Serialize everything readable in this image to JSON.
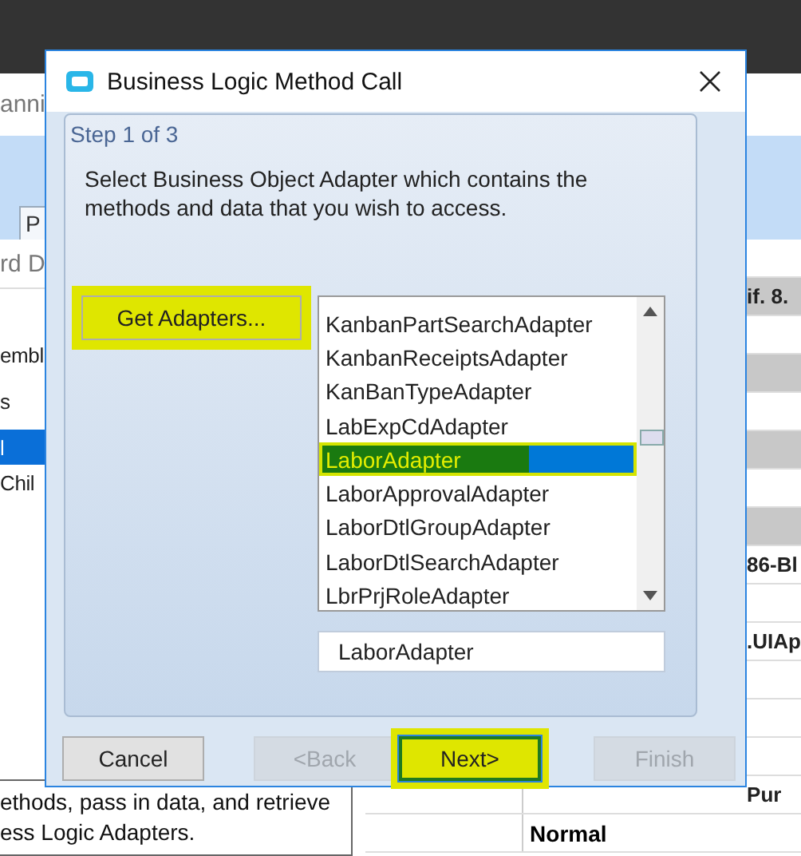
{
  "background_app": {
    "header_text": "anni",
    "tab_label": "P",
    "field_text": "rd D",
    "tree_items": [
      {
        "label": "embl",
        "selected": false
      },
      {
        "label": "s",
        "selected": false
      },
      {
        "label": "l",
        "selected": true
      },
      {
        "label": "Chil",
        "selected": false
      }
    ],
    "grid_rows": [
      {
        "shaded": false
      },
      {
        "shaded": true,
        "column_3": "if. 8."
      },
      {
        "shaded": false
      },
      {
        "shaded": true
      },
      {
        "shaded": false
      },
      {
        "shaded": true
      },
      {
        "shaded": false
      },
      {
        "shaded": true
      },
      {
        "shaded": false,
        "column_3": "86-Bl"
      },
      {
        "shaded": false
      },
      {
        "shaded": false,
        "column_3": ".UIAp"
      },
      {
        "shaded": false
      },
      {
        "shaded": false
      },
      {
        "shaded": false
      },
      {
        "shaded": false,
        "column_3": "Pur"
      },
      {
        "shaded": false,
        "column_2": "Normal"
      }
    ],
    "help_text": "ethods, pass in data, and retrieve\ness Logic Adapters."
  },
  "dialog": {
    "title": "Business Logic Method Call",
    "step": "Step 1 of 3",
    "instruction": "Select Business Object Adapter which contains the methods and data that you wish to access.",
    "get_adapters_button": {
      "label": "Get Adapters...",
      "highlighted": true
    },
    "adapters": [
      {
        "label": "KanbanPartSearchAdapter",
        "selected": false,
        "highlighted": false
      },
      {
        "label": "KanbanReceiptsAdapter",
        "selected": false,
        "highlighted": false
      },
      {
        "label": "KanBanTypeAdapter",
        "selected": false,
        "highlighted": false
      },
      {
        "label": "LabExpCdAdapter",
        "selected": false,
        "highlighted": false
      },
      {
        "label": "LaborAdapter",
        "selected": true,
        "highlighted": true
      },
      {
        "label": "LaborApprovalAdapter",
        "selected": false,
        "highlighted": false
      },
      {
        "label": "LaborDtlGroupAdapter",
        "selected": false,
        "highlighted": false
      },
      {
        "label": "LaborDtlSearchAdapter",
        "selected": false,
        "highlighted": false
      },
      {
        "label": "LbrPrjRoleAdapter",
        "selected": false,
        "highlighted": false
      }
    ],
    "selected_adapter": "LaborAdapter",
    "buttons": [
      {
        "label": "Cancel",
        "disabled": false,
        "highlighted": false
      },
      {
        "label": "<Back",
        "disabled": true,
        "highlighted": false
      },
      {
        "label": "Next>",
        "disabled": false,
        "highlighted": true
      },
      {
        "label": "Finish",
        "disabled": true,
        "highlighted": false
      }
    ]
  }
}
